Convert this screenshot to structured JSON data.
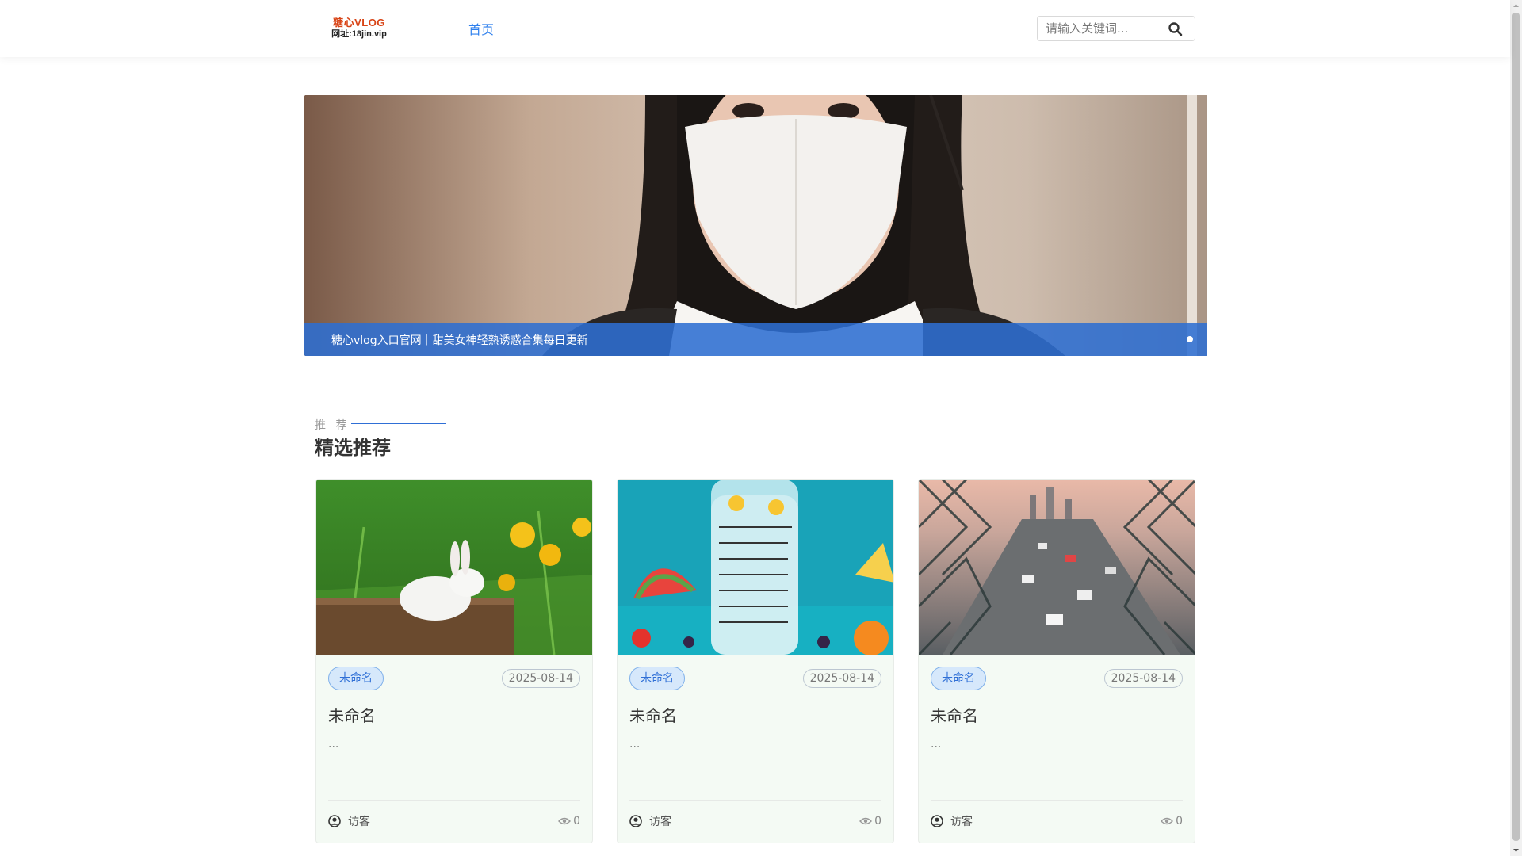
{
  "header": {
    "logo": {
      "line1": "糖心VLOG",
      "line2": "网址:18jin.vip"
    },
    "nav": [
      {
        "label": "首页"
      }
    ],
    "search": {
      "placeholder": "请输入关键词..."
    }
  },
  "banner": {
    "caption": "糖心vlog入口官网｜甜美女神轻熟诱惑合集每日更新",
    "slides_count": 1
  },
  "section": {
    "subtitle": "推 荐",
    "title": "精选推荐"
  },
  "cards": [
    {
      "tag": "未命名",
      "date": "2025-08-14",
      "title": "未命名",
      "excerpt": "...",
      "author": "访客",
      "views": "0",
      "thumb": "rabbit-dandelions"
    },
    {
      "tag": "未命名",
      "date": "2025-08-14",
      "title": "未命名",
      "excerpt": "...",
      "author": "访客",
      "views": "0",
      "thumb": "water-bottle-fruits"
    },
    {
      "tag": "未命名",
      "date": "2025-08-14",
      "title": "未命名",
      "excerpt": "...",
      "author": "访客",
      "views": "0",
      "thumb": "highway-traffic"
    }
  ],
  "colors": {
    "accent": "#2f80ed",
    "caption_bg": "#2d6ed2",
    "card_bg": "#f4faf4",
    "tag_bg": "#d6e8fb"
  },
  "icons": {
    "search": "search-icon",
    "user": "user-circle-icon",
    "views": "eye-icon"
  }
}
